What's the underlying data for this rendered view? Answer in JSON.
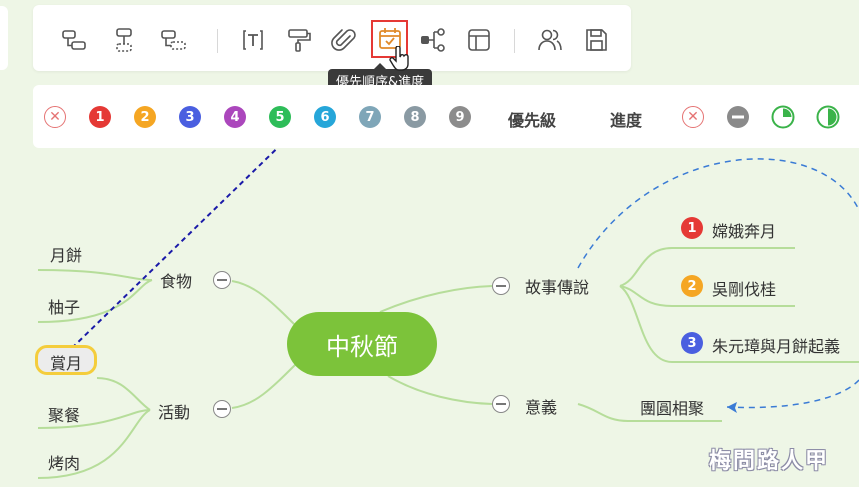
{
  "toolbar": {
    "tooltip": "優先順序&進度",
    "buttons": [
      {
        "icon": "insert-child-icon"
      },
      {
        "icon": "insert-sibling-icon"
      },
      {
        "icon": "insert-parent-icon"
      },
      {
        "icon": "text-icon"
      },
      {
        "icon": "format-painter-icon"
      },
      {
        "icon": "attachment-icon"
      },
      {
        "icon": "priority-progress-icon",
        "active": true
      },
      {
        "icon": "structure-icon"
      },
      {
        "icon": "layout-icon"
      },
      {
        "icon": "users-icon"
      },
      {
        "icon": "save-icon"
      }
    ]
  },
  "priority_bar": {
    "priority_label": "優先級",
    "progress_label": "進度",
    "priorities": [
      {
        "label": "1",
        "color": "#e53935"
      },
      {
        "label": "2",
        "color": "#f5a623"
      },
      {
        "label": "3",
        "color": "#4a5fe0"
      },
      {
        "label": "4",
        "color": "#ab47bc"
      },
      {
        "label": "5",
        "color": "#2ebd59"
      },
      {
        "label": "6",
        "color": "#26a6d9"
      },
      {
        "label": "7",
        "color": "#7fa6b8"
      },
      {
        "label": "8",
        "color": "#8a9aa3"
      },
      {
        "label": "9",
        "color": "#8c8c8c"
      }
    ]
  },
  "mindmap": {
    "center": "中秋節",
    "food": "食物",
    "food_children": [
      "月餅",
      "柚子"
    ],
    "activity": "活動",
    "activity_children": [
      "賞月",
      "聚餐",
      "烤肉"
    ],
    "story": "故事傳說",
    "story_children": [
      {
        "text": "嫦娥奔月",
        "priority": "1",
        "color": "#e53935"
      },
      {
        "text": "吳剛伐桂",
        "priority": "2",
        "color": "#f5a623"
      },
      {
        "text": "朱元璋與月餅起義",
        "priority": "3",
        "color": "#4a5fe0"
      }
    ],
    "meaning": "意義",
    "meaning_children": [
      "團圓相聚"
    ]
  },
  "watermark": "梅問路人甲",
  "colors": {
    "accent": "#7cc33a",
    "line": "#b6dd9a",
    "annotation": "#1a1aa8",
    "dashed_link": "#3a7bd5"
  }
}
